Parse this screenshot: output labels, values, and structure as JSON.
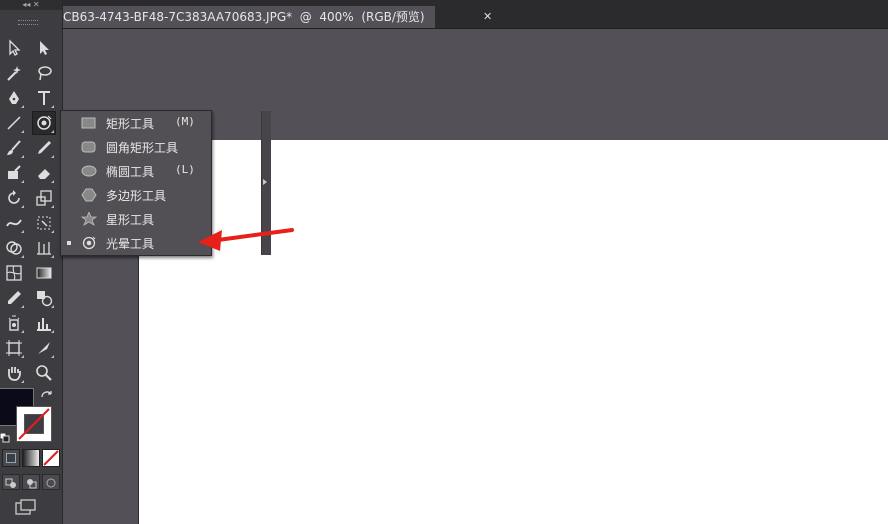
{
  "document_tab": {
    "title": "CB63-4743-BF48-7C383AA70683.JPG*  @  400%  (RGB/预览)",
    "close_glyph": "✕"
  },
  "toolbar": {
    "collapse_glyph": "◂◂ ✕"
  },
  "flyout": {
    "items": [
      {
        "label": "矩形工具",
        "shortcut": "(M)",
        "icon": "rectangle-icon"
      },
      {
        "label": "圆角矩形工具",
        "shortcut": "",
        "icon": "rounded-rectangle-icon"
      },
      {
        "label": "椭圆工具",
        "shortcut": "(L)",
        "icon": "ellipse-icon"
      },
      {
        "label": "多边形工具",
        "shortcut": "",
        "icon": "polygon-icon"
      },
      {
        "label": "星形工具",
        "shortcut": "",
        "icon": "star-icon"
      },
      {
        "label": "光晕工具",
        "shortcut": "",
        "icon": "flare-icon",
        "selected": true
      }
    ]
  },
  "colors": {
    "annotation_arrow": "#e8201a",
    "canvas_bg": "#535058",
    "artboard": "#ffffff"
  }
}
